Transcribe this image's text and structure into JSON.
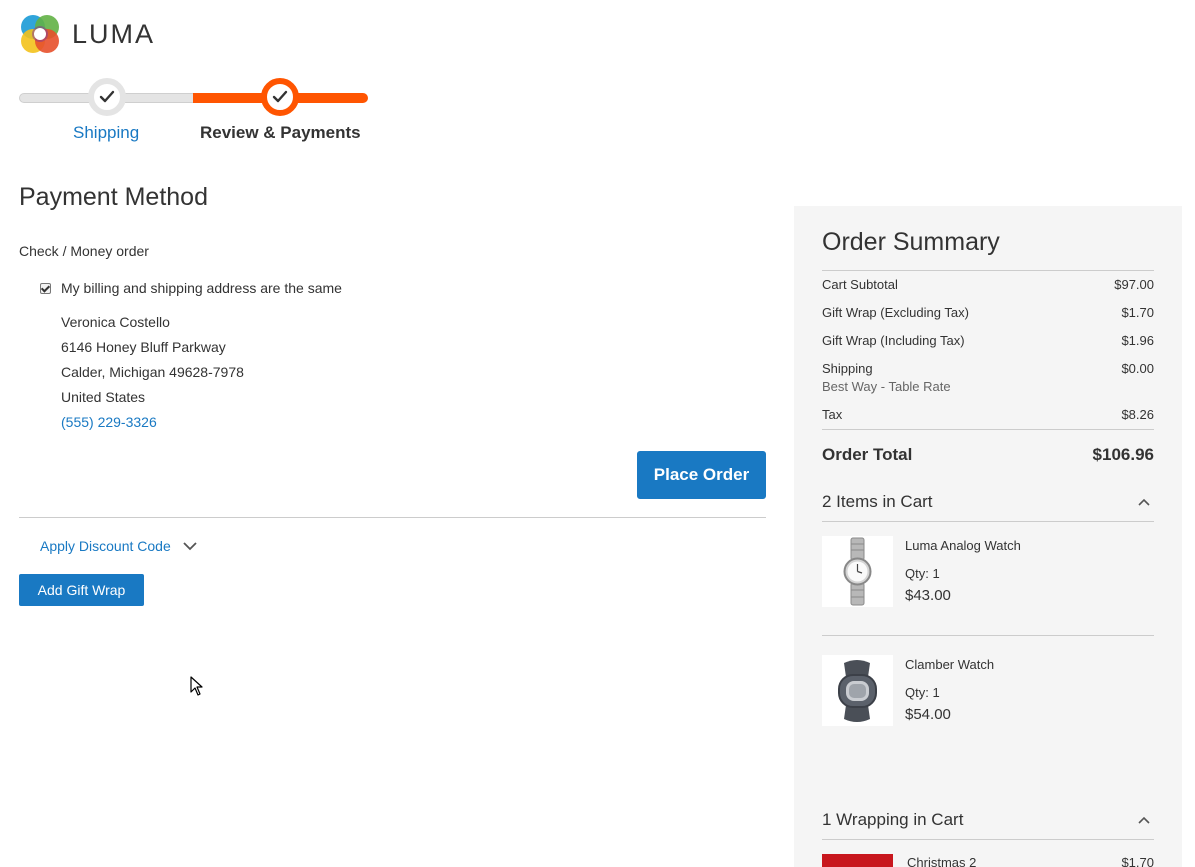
{
  "header": {
    "logo_text": "LUMA"
  },
  "progress": {
    "steps": [
      {
        "label": "Shipping",
        "state": "complete"
      },
      {
        "label": "Review & Payments",
        "state": "active"
      }
    ]
  },
  "payment": {
    "title": "Payment Method",
    "method_label": "Check / Money order",
    "same_address_label": "My billing and shipping address are the same",
    "same_address_checked": true,
    "address": {
      "name": "Veronica Costello",
      "street": "6146 Honey Bluff Parkway",
      "city_line": "Calder, Michigan 49628-7978",
      "country": "United States",
      "phone": "(555) 229-3326"
    },
    "place_order_label": "Place Order",
    "discount_label": "Apply Discount Code",
    "gift_wrap_label": "Add Gift Wrap"
  },
  "summary": {
    "title": "Order Summary",
    "rows": [
      {
        "label": "Cart Subtotal",
        "value": "$97.00"
      },
      {
        "label": "Gift Wrap (Excluding Tax)",
        "value": "$1.70"
      },
      {
        "label": "Gift Wrap (Including Tax)",
        "value": "$1.96"
      },
      {
        "label": "Shipping",
        "value": "$0.00",
        "sub": "Best Way - Table Rate"
      },
      {
        "label": "Tax",
        "value": "$8.26"
      }
    ],
    "total_label": "Order Total",
    "total_value": "$106.96",
    "items_heading": "2 Items in Cart",
    "items": [
      {
        "name": "Luma Analog Watch",
        "qty": "Qty: 1",
        "price": "$43.00",
        "icon": "analog-watch"
      },
      {
        "name": "Clamber Watch",
        "qty": "Qty: 1",
        "price": "$54.00",
        "icon": "sport-watch"
      }
    ],
    "wrapping_heading": "1 Wrapping in Cart",
    "wrapping": {
      "name": "Christmas 2",
      "price": "$1.70"
    }
  },
  "colors": {
    "accent_orange": "#ff5501",
    "link_blue": "#1979c3",
    "summary_bg": "#f5f5f5"
  }
}
